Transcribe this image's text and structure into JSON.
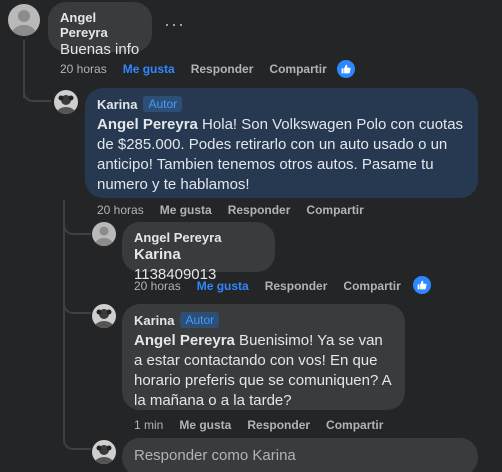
{
  "comment": {
    "author": "Angel Pereyra",
    "text": "Buenas info",
    "time": "20 horas",
    "like": "Me gusta",
    "reply": "Responder",
    "share": "Compartir"
  },
  "reply1": {
    "author": "Karina",
    "badge": "Autor",
    "mention": "Angel Pereyra",
    "text": " Hola! Son Volkswagen Polo con cuotas de $285.000. Podes retirarlo con un auto usado o un anticipo! Tambien tenemos otros autos. Pasame tu numero y te hablamos!",
    "time": "20 horas",
    "like": "Me gusta",
    "reply": "Responder",
    "share": "Compartir"
  },
  "reply2": {
    "author": "Angel Pereyra",
    "mention": "Karina",
    "text": " 1138409013",
    "time": "20 horas",
    "like": "Me gusta",
    "reply": "Responder",
    "share": "Compartir"
  },
  "reply3": {
    "author": "Karina",
    "badge": "Autor",
    "mention": "Angel Pereyra",
    "text": " Buenisimo! Ya se van a estar contactando con vos! En que horario preferis que se comuniquen? A la mañana o a la tarde?",
    "time": "1 min",
    "like": "Me gusta",
    "reply": "Responder",
    "share": "Compartir"
  },
  "reply_input": {
    "placeholder": "Responder como Karina"
  },
  "icons": {
    "more": "more-horizontal-icon",
    "like_badge": "thumbs-up-icon"
  },
  "colors": {
    "background": "#242526",
    "bubble": "#3a3b3c",
    "page_bubble": "#263951",
    "accent": "#2d88ff"
  }
}
